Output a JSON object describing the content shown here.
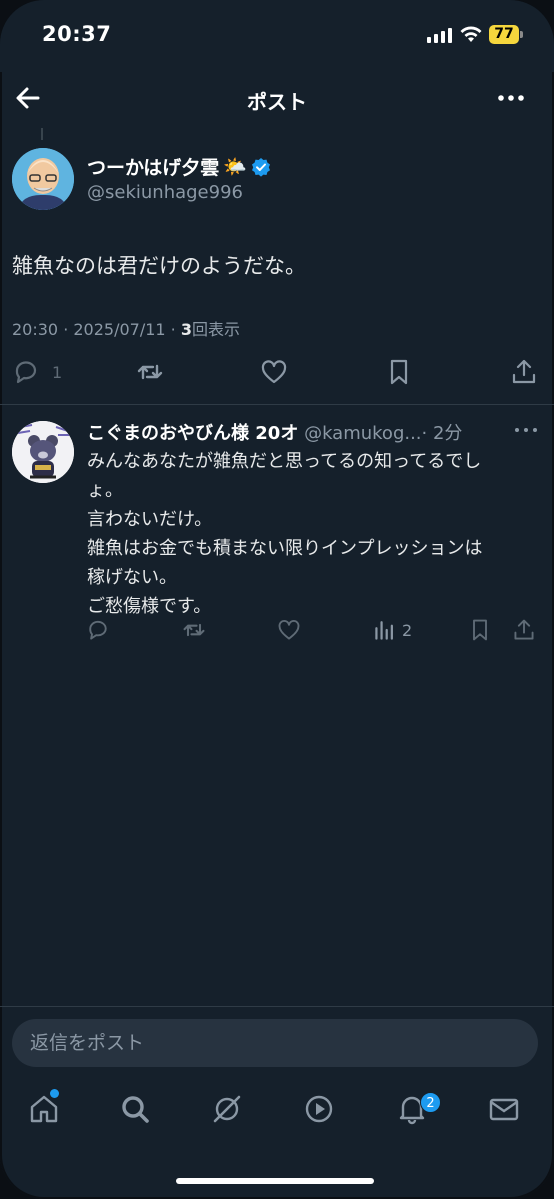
{
  "status_bar": {
    "time": "20:37",
    "battery": "77"
  },
  "header": {
    "title": "ポスト"
  },
  "post": {
    "author_name": "つーかはげ夕雲",
    "author_emoji": "🌤️",
    "author_handle": "@sekiunhage996",
    "text": "雑魚なのは君だけのようだな。",
    "timestamp": "20:30 · 2025/07/11 · ",
    "views_count": "3",
    "views_label": "回表示",
    "reply_count": "1"
  },
  "reply": {
    "author_name": "こぐまのおやびん様 20オ",
    "author_handle": "@kamukog...",
    "time_ago": "· 2分",
    "lines": [
      "みんなあなたが雑魚だと思ってるの知ってるでし",
      "ょ。",
      "言わないだけ。",
      "雑魚はお金でも積まない限りインプレッションは",
      "稼げない。",
      "ご愁傷様です。"
    ],
    "views_count": "2"
  },
  "reply_input": {
    "placeholder": "返信をポスト"
  },
  "tabbar": {
    "notifications_badge": "2"
  },
  "colors": {
    "background": "#15202b",
    "accent": "#1d9bf0",
    "muted": "#8b98a5",
    "battery": "#f5d63d"
  }
}
